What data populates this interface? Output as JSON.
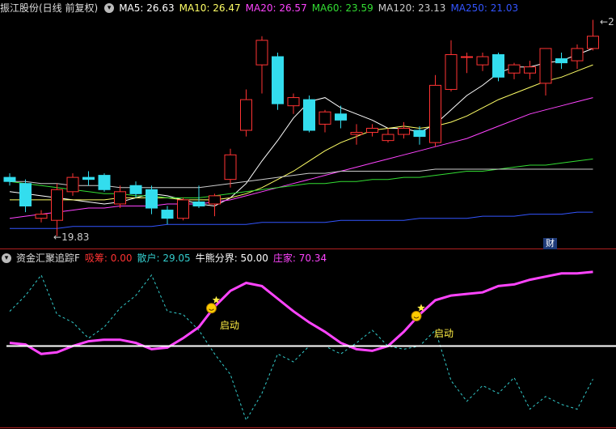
{
  "main_legend": {
    "title": "振江股份(日线 前复权)",
    "items": [
      {
        "label": "MA5",
        "value": "26.63",
        "color": "#ffffff"
      },
      {
        "label": "MA10",
        "value": "26.47",
        "color": "#ffff66"
      },
      {
        "label": "MA20",
        "value": "26.57",
        "color": "#ff44ff"
      },
      {
        "label": "MA60",
        "value": "23.59",
        "color": "#33dd33"
      },
      {
        "label": "MA120",
        "value": "23.13",
        "color": "#cccccc"
      },
      {
        "label": "MA250",
        "value": "21.03",
        "color": "#3355ff"
      }
    ]
  },
  "sub_legend": {
    "title": "资金汇聚追踪F",
    "items": [
      {
        "label": "吸筹",
        "value": "0.00",
        "color": "#ff3333"
      },
      {
        "label": "散户",
        "value": "29.05",
        "color": "#33cccc"
      },
      {
        "label": "牛熊分界",
        "value": "50.00",
        "color": "#ffffff"
      },
      {
        "label": "庄家",
        "value": "70.34",
        "color": "#ff44ff"
      }
    ]
  },
  "annotations": {
    "low_price": "19.83",
    "high_price": "2",
    "signal_label": "启动",
    "finance_badge": "财"
  },
  "colors": {
    "up": "#ff3333",
    "down": "#33ddee",
    "bg": "#000000"
  },
  "chart_data": [
    {
      "type": "candlestick",
      "title": "振江股份(日线 前复权)",
      "ylim": [
        19.5,
        30.5
      ],
      "candles": [
        {
          "o": 22.7,
          "h": 22.9,
          "l": 22.3,
          "c": 22.5
        },
        {
          "o": 22.4,
          "h": 22.6,
          "l": 21.0,
          "c": 21.3
        },
        {
          "o": 20.7,
          "h": 21.1,
          "l": 20.5,
          "c": 20.9
        },
        {
          "o": 20.6,
          "h": 22.4,
          "l": 19.83,
          "c": 22.1
        },
        {
          "o": 22.0,
          "h": 22.9,
          "l": 21.8,
          "c": 22.7
        },
        {
          "o": 22.7,
          "h": 23.0,
          "l": 22.3,
          "c": 22.6
        },
        {
          "o": 22.8,
          "h": 22.9,
          "l": 22.0,
          "c": 22.1
        },
        {
          "o": 21.4,
          "h": 22.3,
          "l": 21.2,
          "c": 22.0
        },
        {
          "o": 22.3,
          "h": 22.5,
          "l": 21.7,
          "c": 21.9
        },
        {
          "o": 22.1,
          "h": 22.3,
          "l": 20.9,
          "c": 21.2
        },
        {
          "o": 21.1,
          "h": 21.3,
          "l": 20.4,
          "c": 20.7
        },
        {
          "o": 20.7,
          "h": 21.7,
          "l": 20.6,
          "c": 21.6
        },
        {
          "o": 21.5,
          "h": 22.3,
          "l": 21.2,
          "c": 21.3
        },
        {
          "o": 21.4,
          "h": 21.9,
          "l": 20.8,
          "c": 21.8
        },
        {
          "o": 22.6,
          "h": 24.1,
          "l": 22.2,
          "c": 23.8
        },
        {
          "o": 25.0,
          "h": 27.0,
          "l": 24.7,
          "c": 26.5
        },
        {
          "o": 28.2,
          "h": 29.6,
          "l": 26.8,
          "c": 29.4
        },
        {
          "o": 28.6,
          "h": 28.8,
          "l": 26.0,
          "c": 26.3
        },
        {
          "o": 26.2,
          "h": 26.8,
          "l": 25.8,
          "c": 26.6
        },
        {
          "o": 26.5,
          "h": 26.7,
          "l": 24.9,
          "c": 25.0
        },
        {
          "o": 25.3,
          "h": 26.0,
          "l": 24.9,
          "c": 25.9
        },
        {
          "o": 25.8,
          "h": 26.2,
          "l": 25.1,
          "c": 25.5
        },
        {
          "o": 24.8,
          "h": 25.3,
          "l": 24.3,
          "c": 24.9
        },
        {
          "o": 24.9,
          "h": 25.3,
          "l": 24.7,
          "c": 25.1
        },
        {
          "o": 24.5,
          "h": 25.1,
          "l": 24.4,
          "c": 24.8
        },
        {
          "o": 24.8,
          "h": 25.4,
          "l": 24.6,
          "c": 25.1
        },
        {
          "o": 25.0,
          "h": 25.2,
          "l": 24.3,
          "c": 24.7
        },
        {
          "o": 24.4,
          "h": 27.7,
          "l": 24.2,
          "c": 27.2
        },
        {
          "o": 27.0,
          "h": 29.4,
          "l": 26.9,
          "c": 28.7
        },
        {
          "o": 28.6,
          "h": 28.8,
          "l": 27.8,
          "c": 28.6
        },
        {
          "o": 28.2,
          "h": 28.8,
          "l": 27.9,
          "c": 28.6
        },
        {
          "o": 28.7,
          "h": 28.8,
          "l": 27.4,
          "c": 27.6
        },
        {
          "o": 27.8,
          "h": 28.3,
          "l": 27.5,
          "c": 28.2
        },
        {
          "o": 27.8,
          "h": 28.4,
          "l": 27.5,
          "c": 28.1
        },
        {
          "o": 27.3,
          "h": 28.7,
          "l": 26.7,
          "c": 29.0
        },
        {
          "o": 28.5,
          "h": 28.8,
          "l": 28.0,
          "c": 28.3
        },
        {
          "o": 28.4,
          "h": 29.2,
          "l": 28.0,
          "c": 29.0
        },
        {
          "o": 29.0,
          "h": 30.4,
          "l": 28.9,
          "c": 29.6
        }
      ],
      "series": [
        {
          "name": "MA5",
          "color": "#ffffff",
          "values": [
            22.0,
            21.9,
            21.8,
            21.7,
            21.6,
            21.5,
            21.4,
            21.5,
            21.7,
            21.9,
            21.8,
            21.6,
            21.4,
            21.3,
            21.7,
            22.4,
            23.5,
            24.5,
            25.6,
            26.4,
            26.6,
            26.1,
            25.8,
            25.5,
            25.1,
            25.1,
            24.9,
            25.3,
            26.0,
            26.7,
            27.2,
            27.8,
            28.1,
            28.1,
            28.3,
            28.4,
            28.7,
            29.0
          ]
        },
        {
          "name": "MA10",
          "color": "#ffff66",
          "values": [
            21.6,
            21.6,
            21.6,
            21.6,
            21.6,
            21.6,
            21.6,
            21.7,
            21.7,
            21.7,
            21.7,
            21.6,
            21.6,
            21.6,
            21.7,
            21.9,
            22.2,
            22.6,
            23.0,
            23.5,
            24.0,
            24.4,
            24.7,
            25.0,
            25.1,
            25.2,
            25.1,
            25.2,
            25.4,
            25.7,
            26.1,
            26.5,
            26.8,
            27.1,
            27.4,
            27.6,
            27.9,
            28.2
          ]
        },
        {
          "name": "MA20",
          "color": "#ff44ff",
          "values": [
            20.7,
            20.8,
            20.9,
            21.0,
            21.1,
            21.2,
            21.2,
            21.3,
            21.3,
            21.3,
            21.4,
            21.4,
            21.4,
            21.5,
            21.6,
            21.8,
            22.0,
            22.2,
            22.4,
            22.6,
            22.8,
            23.0,
            23.2,
            23.4,
            23.6,
            23.8,
            24.0,
            24.2,
            24.4,
            24.6,
            24.9,
            25.2,
            25.5,
            25.8,
            26.0,
            26.2,
            26.4,
            26.6
          ]
        },
        {
          "name": "MA60",
          "color": "#33dd33",
          "values": [
            22.5,
            22.4,
            22.3,
            22.2,
            22.1,
            22.0,
            21.9,
            21.9,
            21.8,
            21.8,
            21.7,
            21.7,
            21.7,
            21.8,
            21.9,
            22.0,
            22.1,
            22.2,
            22.3,
            22.4,
            22.4,
            22.5,
            22.5,
            22.6,
            22.6,
            22.7,
            22.7,
            22.8,
            22.9,
            23.0,
            23.0,
            23.1,
            23.2,
            23.3,
            23.3,
            23.4,
            23.5,
            23.6
          ]
        },
        {
          "name": "MA120",
          "color": "#cccccc",
          "values": [
            22.5,
            22.5,
            22.4,
            22.4,
            22.3,
            22.3,
            22.3,
            22.2,
            22.2,
            22.2,
            22.2,
            22.2,
            22.2,
            22.3,
            22.4,
            22.5,
            22.6,
            22.7,
            22.8,
            22.9,
            22.9,
            23.0,
            23.0,
            23.0,
            23.0,
            23.0,
            23.0,
            23.1,
            23.1,
            23.1,
            23.1,
            23.1,
            23.1,
            23.1,
            23.1,
            23.1,
            23.1,
            23.1
          ]
        },
        {
          "name": "MA250",
          "color": "#3355ff",
          "values": [
            20.2,
            20.2,
            20.2,
            20.2,
            20.3,
            20.3,
            20.3,
            20.3,
            20.3,
            20.3,
            20.4,
            20.4,
            20.4,
            20.4,
            20.4,
            20.4,
            20.5,
            20.5,
            20.5,
            20.5,
            20.5,
            20.6,
            20.6,
            20.6,
            20.6,
            20.6,
            20.7,
            20.7,
            20.7,
            20.7,
            20.8,
            20.8,
            20.8,
            20.9,
            20.9,
            20.9,
            21.0,
            21.0
          ]
        }
      ]
    },
    {
      "type": "line",
      "title": "资金汇聚追踪F",
      "ylim": [
        0,
        100
      ],
      "x": [
        0,
        1,
        2,
        3,
        4,
        5,
        6,
        7,
        8,
        9,
        10,
        11,
        12,
        13,
        14,
        15,
        16,
        17,
        18,
        19,
        20,
        21,
        22,
        23,
        24,
        25,
        26,
        27,
        28,
        29,
        30,
        31,
        32,
        33,
        34,
        35,
        36,
        37
      ],
      "series": [
        {
          "name": "散户",
          "color": "#33cccc",
          "dashed": true,
          "values": [
            72,
            82,
            95,
            70,
            65,
            55,
            62,
            74,
            82,
            95,
            72,
            70,
            60,
            45,
            32,
            3,
            20,
            45,
            40,
            50,
            50,
            45,
            52,
            60,
            50,
            48,
            50,
            60,
            28,
            15,
            25,
            20,
            30,
            10,
            18,
            13,
            10,
            29
          ]
        },
        {
          "name": "庄家",
          "color": "#ff44ff",
          "values": [
            52,
            51,
            45,
            46,
            50,
            53,
            54,
            54,
            52,
            48,
            49,
            55,
            62,
            75,
            85,
            90,
            88,
            80,
            72,
            65,
            59,
            52,
            48,
            47,
            50,
            59,
            70,
            79,
            82,
            83,
            84,
            88,
            89,
            92,
            94,
            96,
            96,
            97
          ]
        },
        {
          "name": "牛熊分界",
          "color": "#ffffff",
          "values": [
            50,
            50,
            50,
            50,
            50,
            50,
            50,
            50,
            50,
            50,
            50,
            50,
            50,
            50,
            50,
            50,
            50,
            50,
            50,
            50,
            50,
            50,
            50,
            50,
            50,
            50,
            50,
            50,
            50,
            50,
            50,
            50,
            50,
            50,
            50,
            50,
            50,
            50
          ]
        }
      ],
      "signals": [
        {
          "index": 13,
          "label": "启动"
        },
        {
          "index": 26,
          "label": "启动"
        }
      ]
    }
  ]
}
